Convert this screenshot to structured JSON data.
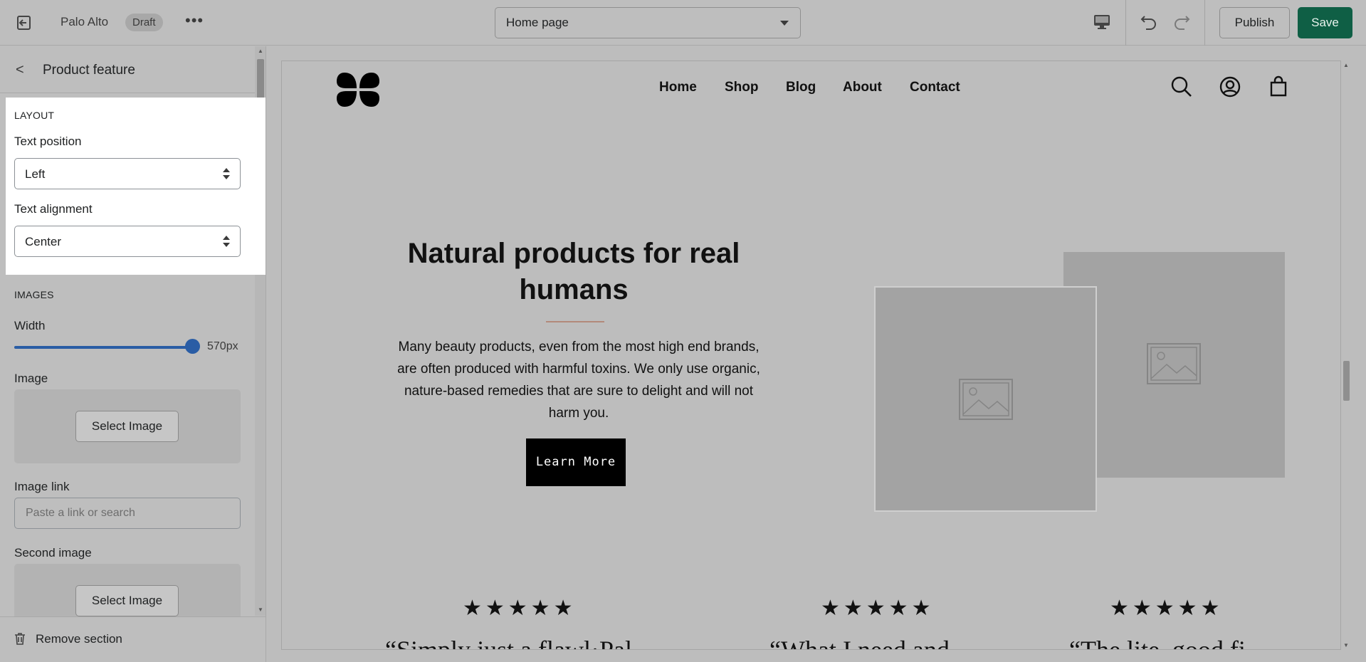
{
  "topbar": {
    "store_name": "Palo Alto",
    "status_badge": "Draft",
    "more_label": "•••",
    "page_select": "Home page",
    "publish_label": "Publish",
    "save_label": "Save"
  },
  "sidebar": {
    "back_label": "<",
    "title": "Product feature",
    "layout_heading": "LAYOUT",
    "text_position_label": "Text position",
    "text_position_value": "Left",
    "text_alignment_label": "Text alignment",
    "text_alignment_value": "Center",
    "images_heading": "IMAGES",
    "width_label": "Width",
    "width_value": "570px",
    "image_label": "Image",
    "select_image_label": "Select Image",
    "image_link_label": "Image link",
    "image_link_placeholder": "Paste a link or search",
    "second_image_label": "Second image",
    "select_second_image_label": "Select Image",
    "remove_section_label": "Remove section"
  },
  "preview": {
    "nav": [
      "Home",
      "Shop",
      "Blog",
      "About",
      "Contact"
    ],
    "hero_title": "Natural products for real humans",
    "hero_body": "Many beauty products, even from the most high end brands, are often produced with harmful toxins. We only use organic, nature-based remedies that are sure to delight and will not harm you.",
    "hero_button": "Learn More",
    "stars": "★★★★★",
    "quotes": [
      "“Simply just a flawl·Pal",
      "“What I need and",
      "“The lite, good fi"
    ]
  },
  "colors": {
    "accent": "#2a5da5",
    "save_button": "#0f5f45",
    "overlay_gray": "#bdbdbd",
    "rule": "#b38a7a"
  }
}
